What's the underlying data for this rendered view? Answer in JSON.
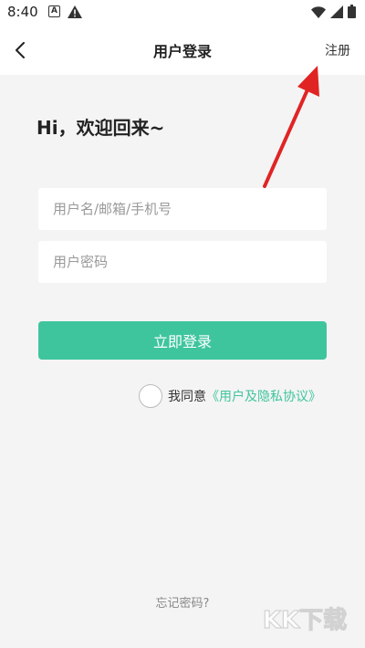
{
  "status_bar": {
    "time": "8:40",
    "icons": [
      "a-notification-icon",
      "warning-icon",
      "wifi-icon",
      "signal-icon",
      "battery-icon"
    ]
  },
  "nav": {
    "title": "用户登录",
    "register_label": "注册"
  },
  "greeting": "Hi，欢迎回来~",
  "form": {
    "username_placeholder": "用户名/邮箱/手机号",
    "username_value": "",
    "password_placeholder": "用户密码",
    "password_value": "",
    "login_label": "立即登录",
    "agree_text": "我同意",
    "agree_link": "《用户及隐私协议》",
    "agreed": false
  },
  "forgot_label": "忘记密码?",
  "watermark": "KK下载",
  "colors": {
    "accent": "#3fc59e",
    "arrow": "#e02424"
  }
}
